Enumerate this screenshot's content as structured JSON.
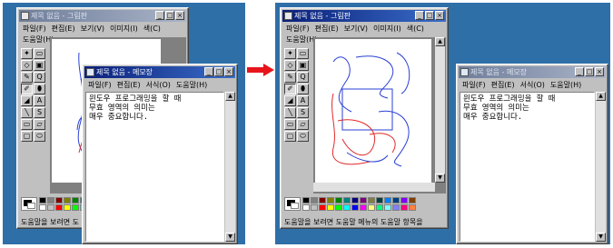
{
  "before": {
    "paint": {
      "title": "제목 없음 - 그림판",
      "menu": [
        "파일(F)",
        "편집(E)",
        "보기(V)",
        "이미지(I)",
        "색(C)",
        "도움말(H)"
      ],
      "status": "도움말을 보려면 도"
    },
    "notepad": {
      "title": "제목 없음 - 메모장",
      "menu": [
        "파일(F)",
        "편집(E)",
        "서식(O)",
        "도움말(H)"
      ],
      "lines": [
        "윈도우 프로그래밍을 할 때",
        "무효 영역의 의미는",
        "매우 중요합니다."
      ]
    }
  },
  "after": {
    "paint": {
      "title": "제목 없음 - 그림판",
      "menu": [
        "파일(F)",
        "편집(E)",
        "보기(V)",
        "이미지(I)",
        "색(C)",
        "도움말(H)"
      ],
      "status": "도움말을 보려면 도움말 메뉴의 도움말 항목을"
    },
    "notepad": {
      "title": "제목 없음 - 메모장",
      "menu": [
        "파일(F)",
        "편집(E)",
        "서식(O)",
        "도움말(H)"
      ],
      "lines": [
        "윈도우 프로그래밍을 할 때",
        "무효 영역의 의미는",
        "매우 중요합니다."
      ]
    }
  },
  "window_buttons": {
    "minimize": "_",
    "maximize": "□",
    "close": "×"
  },
  "tools": [
    "✦",
    "▭",
    "◇",
    "▣",
    "✎",
    "⬮",
    "✐",
    "A",
    "◢",
    "Q",
    "╲",
    "S",
    "▭",
    "▱",
    "▢",
    "⬭"
  ],
  "palette_colors": [
    "#000000",
    "#808080",
    "#800000",
    "#808000",
    "#008000",
    "#008080",
    "#000080",
    "#800080",
    "#808040",
    "#004040",
    "#0080ff",
    "#004080",
    "#8000ff",
    "#804000",
    "#ffffff",
    "#c0c0c0",
    "#ff0000",
    "#ffff00",
    "#00ff00",
    "#00ffff",
    "#0000ff",
    "#ff00ff",
    "#ffff80",
    "#00ff80",
    "#80ffff",
    "#8080ff",
    "#ff0080",
    "#ff8040"
  ],
  "colors": {
    "desktop": "#2f6fa8",
    "arrow": "#e8141c",
    "stroke_blue": "#2a3fd6",
    "stroke_red": "#e02a2a"
  }
}
